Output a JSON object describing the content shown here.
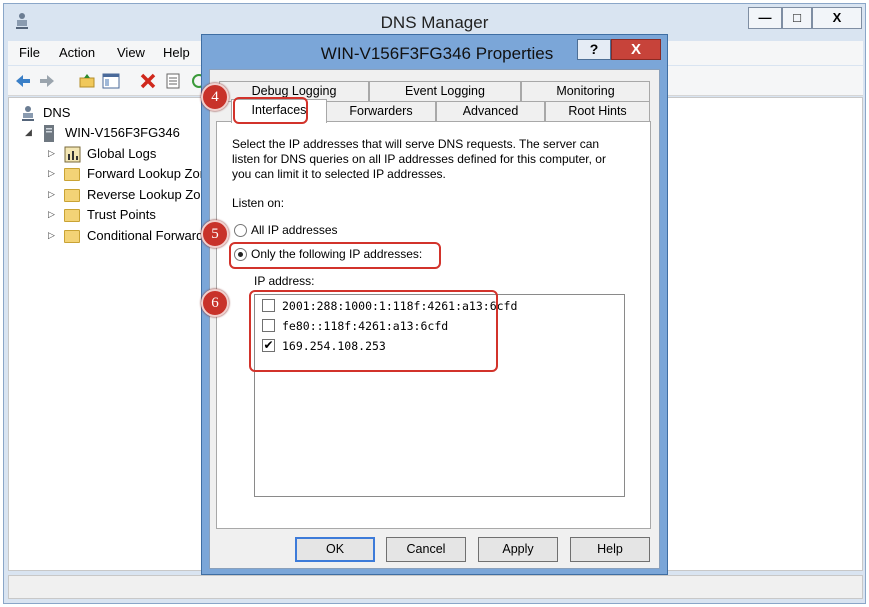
{
  "main_window": {
    "title": "DNS Manager",
    "min_label": "—",
    "max_label": "□",
    "close_label": "X"
  },
  "menu": [
    "File",
    "Action",
    "View",
    "Help"
  ],
  "tree": {
    "root": "DNS",
    "server": "WIN-V156F3FG346",
    "children": [
      "Global Logs",
      "Forward Lookup Zon",
      "Reverse Lookup Zon",
      "Trust Points",
      "Conditional Forward"
    ]
  },
  "dialog": {
    "title": "WIN-V156F3FG346 Properties",
    "help_label": "?",
    "close_label": "X",
    "tabs_row1": [
      "Debug Logging",
      "Event Logging",
      "Monitoring"
    ],
    "tabs_row2": [
      "Interfaces",
      "Forwarders",
      "Advanced",
      "Root Hints"
    ],
    "active_tab": "Interfaces",
    "description": [
      "Select the IP addresses that will serve DNS requests. The server can",
      "listen for DNS queries on all IP addresses defined for this computer, or",
      "you can limit it to selected IP addresses."
    ],
    "listen_on_label": "Listen on:",
    "radio_all": "All IP addresses",
    "radio_only": "Only the following IP addresses:",
    "radio_selected": "only",
    "ip_address_label": "IP address:",
    "ip_list": [
      {
        "address": "2001:288:1000:1:118f:4261:a13:6cfd",
        "checked": false
      },
      {
        "address": "fe80::118f:4261:a13:6cfd",
        "checked": false
      },
      {
        "address": "169.254.108.253",
        "checked": true
      }
    ],
    "buttons": {
      "ok": "OK",
      "cancel": "Cancel",
      "apply": "Apply",
      "help": "Help"
    }
  },
  "markers": [
    "4",
    "5",
    "6"
  ],
  "colors": {
    "highlight": "#d2332b",
    "marker": "#c8322a",
    "dialog_frame": "#7ba6d8",
    "close_button": "#c7433a"
  }
}
